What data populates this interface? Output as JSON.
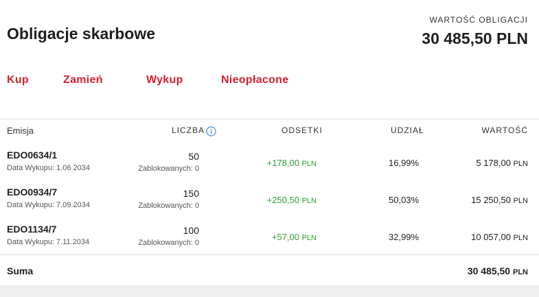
{
  "page": {
    "title": "Obligacje skarbowe"
  },
  "summary": {
    "label": "WARTOŚĆ OBLIGACJI",
    "amount": "30 485,50 PLN"
  },
  "actions": {
    "buy": "Kup",
    "exchange": "Zamień",
    "redeem": "Wykup",
    "unpaid": "Nieopłacone"
  },
  "table": {
    "headers": {
      "issue": "Emisja",
      "count": "LICZBA",
      "interest": "ODSETKI",
      "share": "UDZIAŁ",
      "value": "WARTOŚĆ"
    },
    "rows": [
      {
        "name": "EDO0634/1",
        "date": "Data Wykupu: 1.06.2034",
        "count": "50",
        "blocked": "Zablokowanych: 0",
        "interest": "+178,00",
        "interest_cur": "PLN",
        "share": "16,99%",
        "value": "5 178,00",
        "value_cur": "PLN"
      },
      {
        "name": "EDO0934/7",
        "date": "Data Wykupu: 7.09.2034",
        "count": "150",
        "blocked": "Zablokowanych: 0",
        "interest": "+250,50",
        "interest_cur": "PLN",
        "share": "50,03%",
        "value": "15 250,50",
        "value_cur": "PLN"
      },
      {
        "name": "EDO1134/7",
        "date": "Data Wykupu: 7.11.2034",
        "count": "100",
        "blocked": "Zablokowanych: 0",
        "interest": "+57,00",
        "interest_cur": "PLN",
        "share": "32,99%",
        "value": "10 057,00",
        "value_cur": "PLN"
      }
    ],
    "total": {
      "label": "Suma",
      "value": "30 485,50",
      "value_cur": "PLN"
    }
  },
  "colors": {
    "accent": "#d1222f",
    "positive": "#2e9e2e",
    "info": "#3b7fd4"
  },
  "icons": {
    "info": "info-icon"
  }
}
